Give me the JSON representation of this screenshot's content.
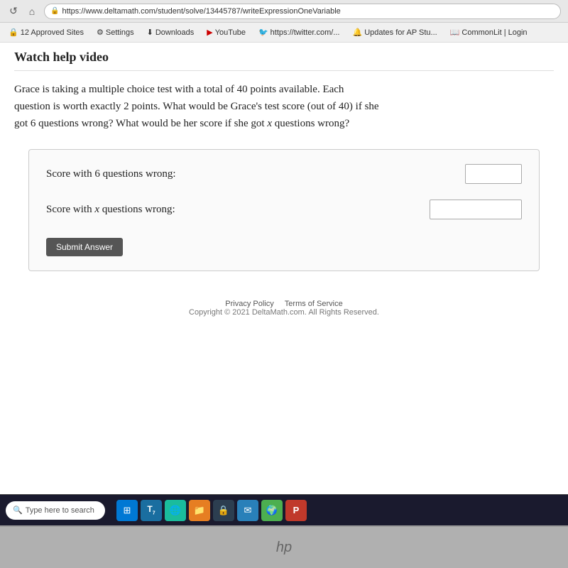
{
  "browser": {
    "url": "https://www.deltamath.com/student/solve/13445787/writeExpressionOneVariable",
    "nav_back": "←",
    "nav_reload": "↺",
    "nav_home": "⌂"
  },
  "bookmarks": [
    {
      "id": "approved-sites",
      "label": "12 Approved Sites",
      "icon": "🔒"
    },
    {
      "id": "settings",
      "label": "Settings",
      "icon": "⚙"
    },
    {
      "id": "downloads",
      "label": "Downloads",
      "icon": "⬇"
    },
    {
      "id": "youtube",
      "label": "YouTube",
      "icon": "▶"
    },
    {
      "id": "twitter",
      "label": "https://twitter.com/...",
      "icon": "🐦"
    },
    {
      "id": "updates",
      "label": "Updates for AP Stu...",
      "icon": "🔔"
    },
    {
      "id": "commonlit",
      "label": "CommonLit | Login",
      "icon": "📖"
    }
  ],
  "page": {
    "watch_help": "Watch help video",
    "problem_text_1": "Grace is taking a multiple choice test with a total of 40 points available. Each",
    "problem_text_2": "question is worth exactly 2 points. What would be Grace's test score (out of 40) if she",
    "problem_text_3": "got 6 questions wrong? What would be her score if she got",
    "problem_text_x": "x",
    "problem_text_4": "questions wrong?",
    "score_6_label": "Score with 6 questions wrong:",
    "score_x_label": "Score with",
    "score_x_mid": "x",
    "score_x_end": "questions wrong:",
    "submit_label": "Submit Answer"
  },
  "footer": {
    "privacy": "Privacy Policy",
    "terms": "Terms of Service",
    "copyright": "Copyright © 2021 DeltaMath.com. All Rights Reserved."
  },
  "taskbar": {
    "search_placeholder": "Type here to search",
    "icons": [
      "⊞",
      "📋",
      "🌐",
      "📁",
      "🔒",
      "✉",
      "🌍",
      "📊"
    ]
  }
}
